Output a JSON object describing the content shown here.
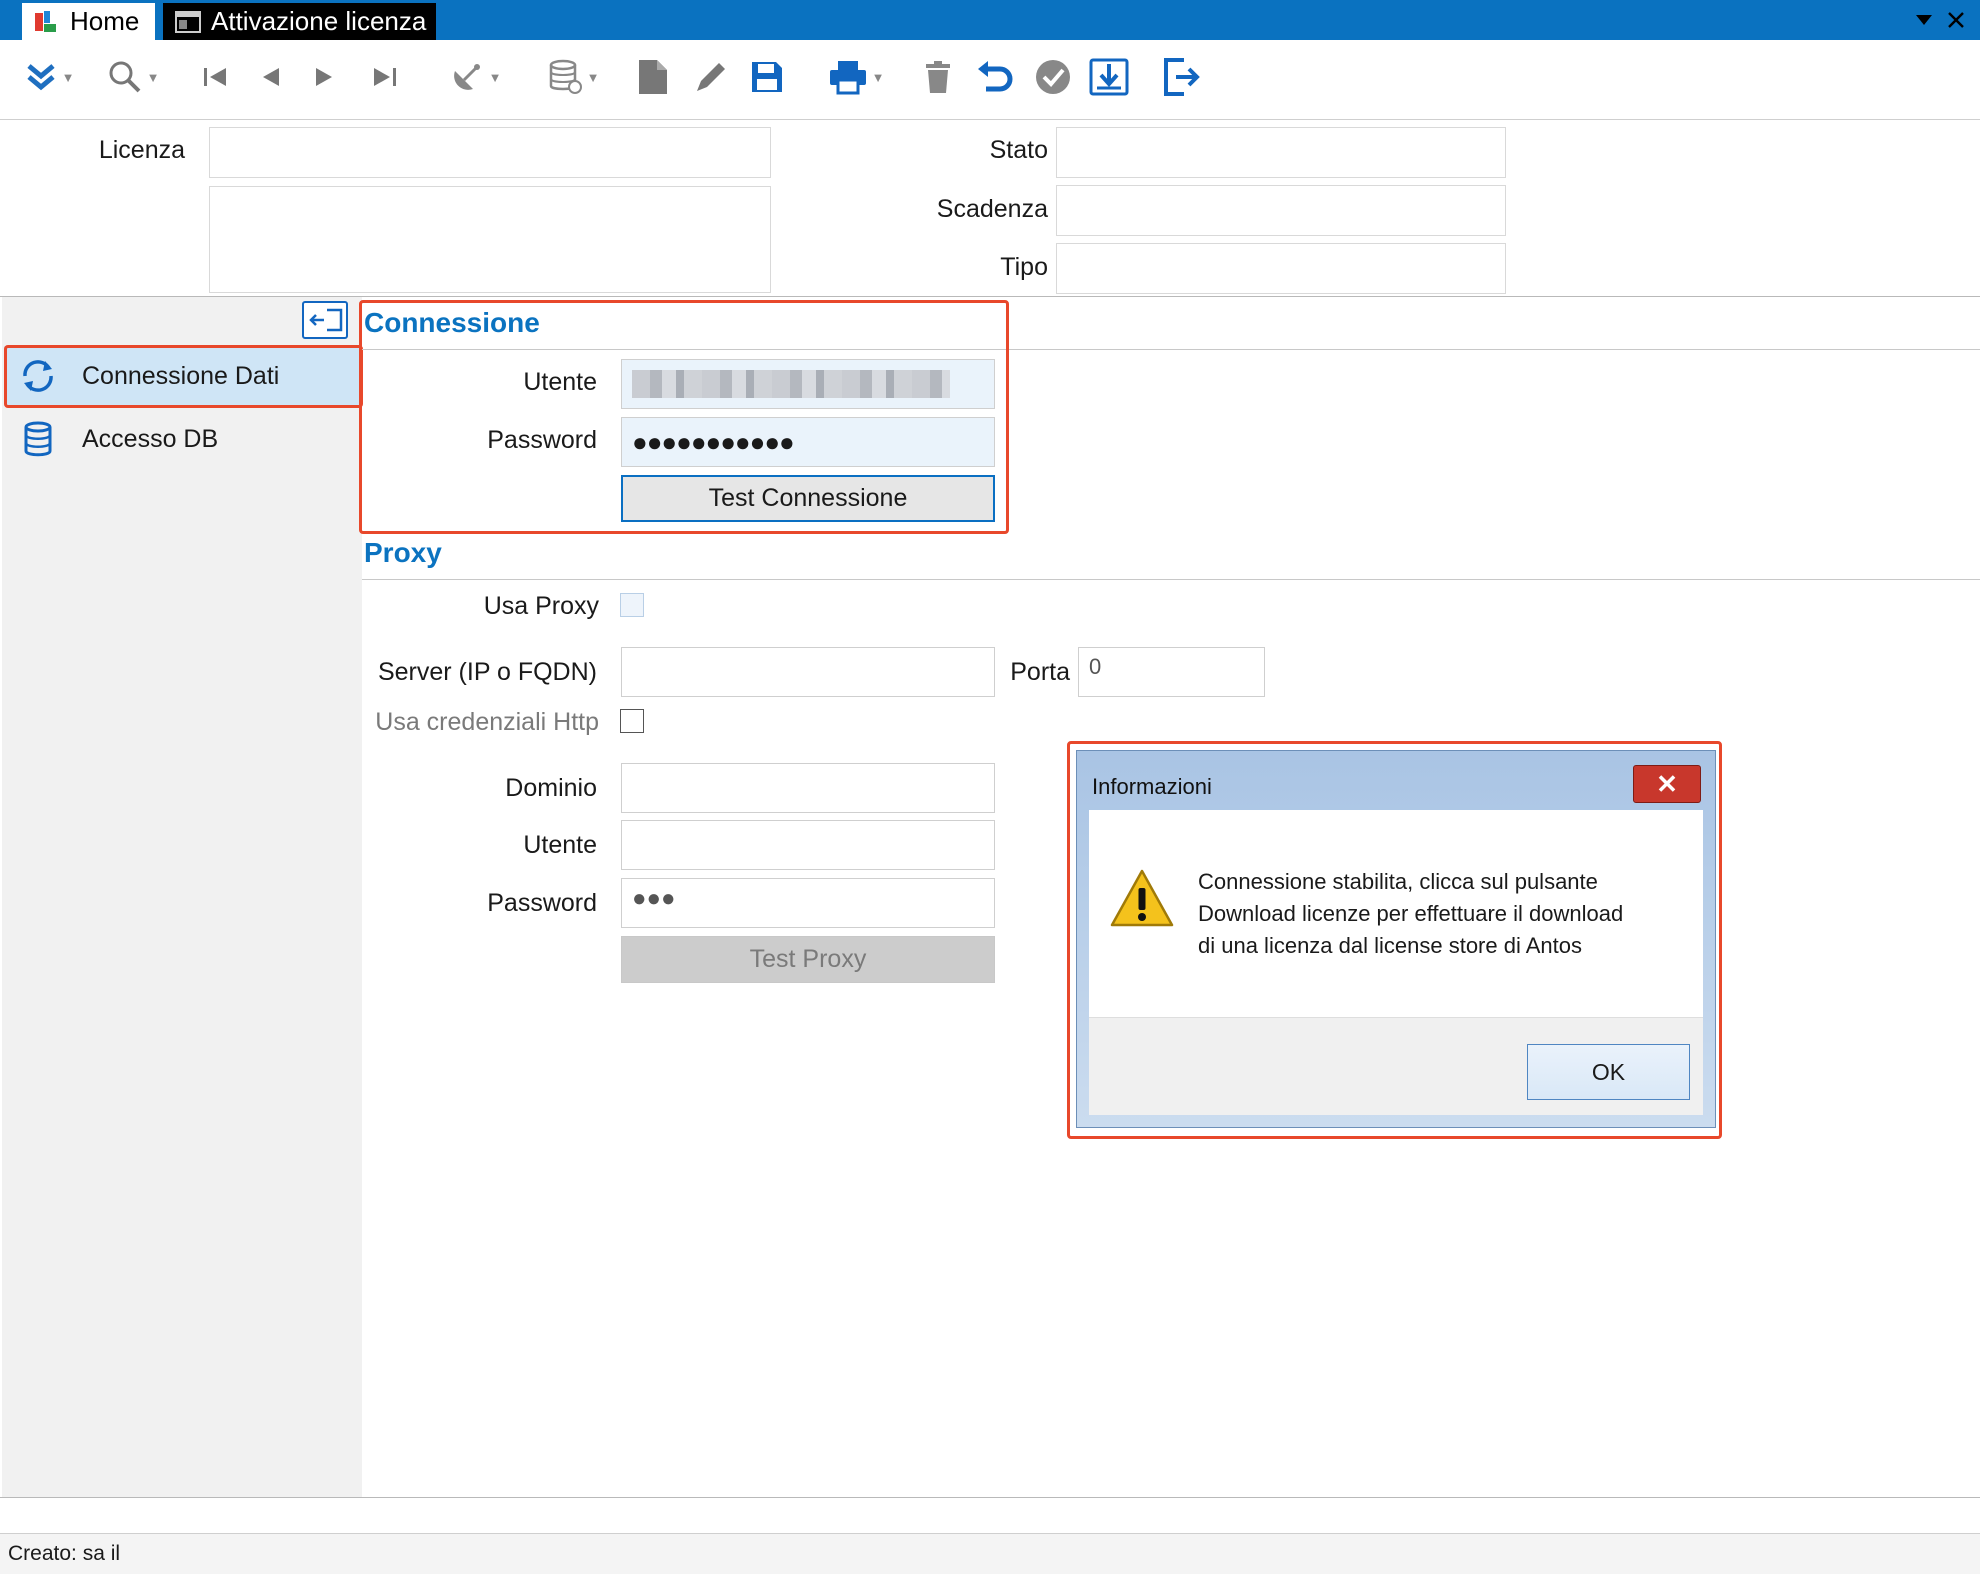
{
  "tabs": {
    "home": "Home",
    "active": "Attivazione licenza"
  },
  "toolbar": {
    "icons": [
      "expand-icon",
      "search-icon",
      "first-record-icon",
      "previous-record-icon",
      "next-record-icon",
      "last-record-icon",
      "satellite-icon",
      "database-sync-icon",
      "new-document-icon",
      "edit-icon",
      "save-icon",
      "print-icon",
      "delete-icon",
      "undo-icon",
      "confirm-icon",
      "download-icon",
      "exit-icon"
    ]
  },
  "header": {
    "licenza_label": "Licenza",
    "stato_label": "Stato",
    "scadenza_label": "Scadenza",
    "tipo_label": "Tipo",
    "licenza_value": "",
    "descrizione_value": "",
    "stato_value": "",
    "scadenza_value": "",
    "tipo_value": ""
  },
  "sidebar": {
    "items": [
      {
        "label": "Connessione Dati",
        "icon": "sync-icon",
        "selected": true
      },
      {
        "label": "Accesso DB",
        "icon": "database-icon",
        "selected": false
      }
    ]
  },
  "connessione": {
    "title": "Connessione",
    "utente_label": "Utente",
    "password_label": "Password",
    "password_value": "●●●●●●●●●●●",
    "test_button": "Test Connessione"
  },
  "proxy": {
    "title": "Proxy",
    "usa_proxy_label": "Usa Proxy",
    "server_label": "Server (IP o FQDN)",
    "server_value": "",
    "porta_label": "Porta",
    "porta_value": "0",
    "usa_credenziali_label": "Usa credenziali Http",
    "dominio_label": "Dominio",
    "dominio_value": "",
    "utente_label": "Utente",
    "utente_value": "",
    "password_label": "Password",
    "password_value": "●●●",
    "test_button": "Test Proxy"
  },
  "dialog": {
    "title": "Informazioni",
    "close": "✕",
    "message_lines": [
      "Connessione stabilita, clicca sul pulsante",
      "Download licenze per effettuare il download",
      "di una licenza dal license store di Antos"
    ],
    "ok_button": "OK",
    "icon": "warning-icon"
  },
  "status": {
    "text": "Creato: sa il"
  },
  "colors": {
    "accent": "#0a72c0",
    "highlight": "#e8482b",
    "selected": "#cfe5f6"
  }
}
